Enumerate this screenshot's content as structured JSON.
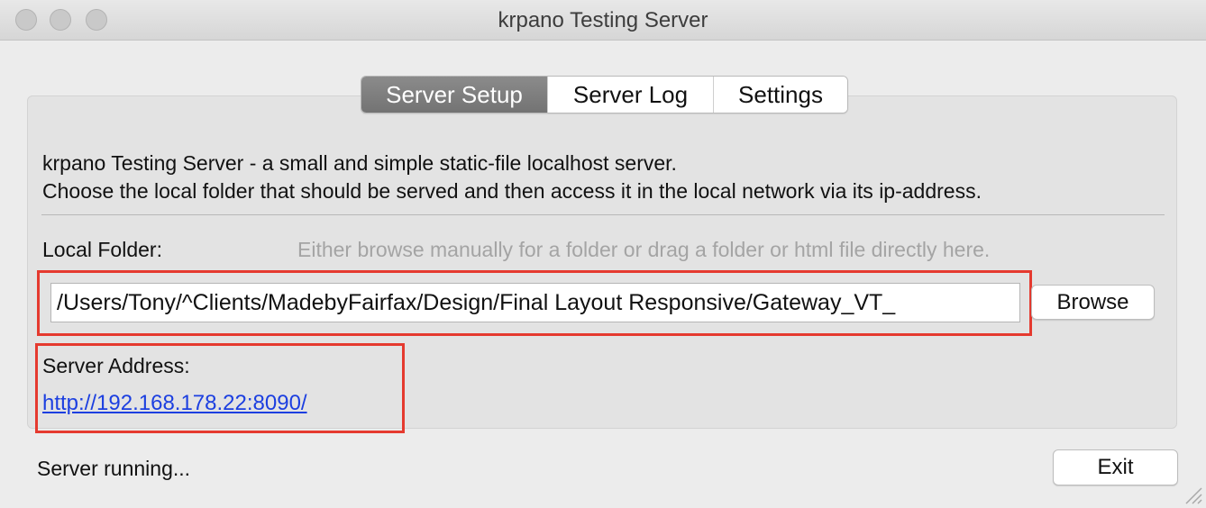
{
  "window": {
    "title": "krpano Testing Server"
  },
  "tabs": [
    {
      "label": "Server Setup",
      "active": true
    },
    {
      "label": "Server Log",
      "active": false
    },
    {
      "label": "Settings",
      "active": false
    }
  ],
  "setup": {
    "description_line1": "krpano Testing Server - a small and simple static-file localhost server.",
    "description_line2": "Choose the local folder that should be served and then access it in the local network via its ip-address.",
    "local_folder_label": "Local Folder:",
    "local_folder_hint": "Either browse manually for a folder or drag a folder or html file directly here.",
    "local_folder_value": "/Users/Tony/^Clients/MadebyFairfax/Design/Final Layout Responsive/Gateway_VT_",
    "browse_label": "Browse",
    "server_address_label": "Server Address:",
    "server_address_url": "http://192.168.178.22:8090/"
  },
  "footer": {
    "status": "Server running...",
    "exit_label": "Exit"
  },
  "colors": {
    "link": "#1c3fe0",
    "highlight_box": "#e53a2f",
    "active_tab": "#7f7f7f"
  }
}
